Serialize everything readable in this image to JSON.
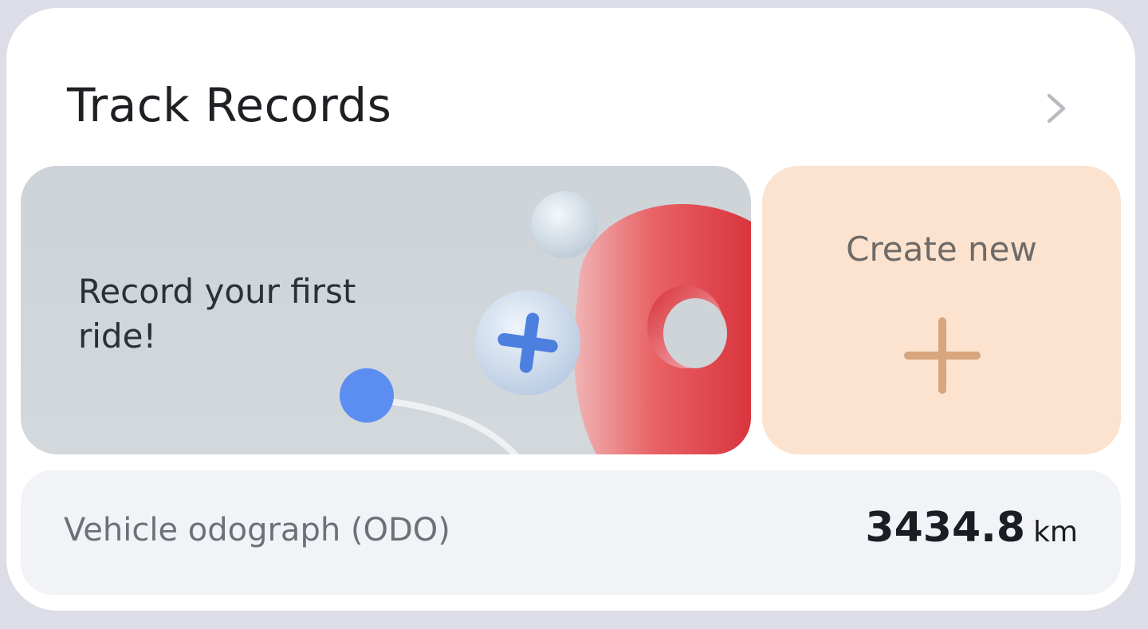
{
  "header": {
    "title": "Track Records",
    "chevron_icon": "chevron-right-icon"
  },
  "banner": {
    "text": "Record your first ride!",
    "art": {
      "plus_icon": "plus-icon",
      "pin_icon": "map-pin-icon",
      "colors": {
        "plus": "#4d7fe0",
        "pin": "#e0424a",
        "dot": "#5b8ef0"
      }
    }
  },
  "create": {
    "label": "Create new",
    "icon": "plus-icon",
    "background": "#fbe3cf",
    "icon_color": "#d8a67e"
  },
  "odo": {
    "label": "Vehicle odograph (ODO)",
    "value": "3434.8",
    "unit": "km"
  }
}
